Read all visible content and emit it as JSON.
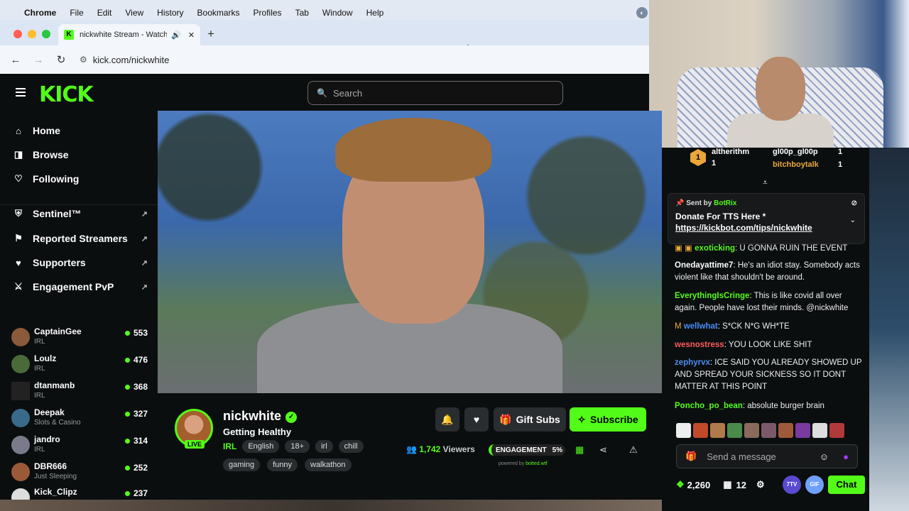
{
  "menubar": {
    "apple": "",
    "items": [
      "Chrome",
      "File",
      "Edit",
      "View",
      "History",
      "Bookmarks",
      "Profiles",
      "Tab",
      "Window",
      "Help"
    ]
  },
  "browser": {
    "tab_title": "nickwhite Stream - Watch",
    "tab_close": "✕",
    "new_tab": "+",
    "url": "kick.com/nickwhite"
  },
  "kick": {
    "logo": "KICK",
    "search_placeholder": "Search"
  },
  "sidebar": {
    "nav": [
      {
        "label": "Home",
        "icon": "home-icon",
        "glyph": "⌂"
      },
      {
        "label": "Browse",
        "icon": "browse-icon",
        "glyph": "◨"
      },
      {
        "label": "Following",
        "icon": "heart-icon",
        "glyph": "♡"
      }
    ],
    "tools": [
      {
        "label": "Sentinel™",
        "glyph": "⛨"
      },
      {
        "label": "Reported Streamers",
        "glyph": "⚑"
      },
      {
        "label": "Supporters",
        "glyph": "♥"
      },
      {
        "label": "Engagement PvP",
        "glyph": "⚔"
      }
    ],
    "channels": [
      {
        "name": "CaptainGee",
        "category": "IRL",
        "viewers": "553"
      },
      {
        "name": "Loulz",
        "category": "IRL",
        "viewers": "476"
      },
      {
        "name": "dtanmanb",
        "category": "IRL",
        "viewers": "368"
      },
      {
        "name": "Deepak",
        "category": "Slots & Casino",
        "viewers": "327"
      },
      {
        "name": "jandro",
        "category": "IRL",
        "viewers": "314"
      },
      {
        "name": "DBR666",
        "category": "Just Sleeping",
        "viewers": "252"
      },
      {
        "name": "Kick_Clipz",
        "category": "",
        "viewers": "237"
      }
    ]
  },
  "stream": {
    "streamer": "nickwhite",
    "title": "Getting Healthy",
    "category": "IRL",
    "live_badge": "LIVE",
    "tags": [
      "English",
      "18+",
      "irl",
      "chill"
    ],
    "tags2": [
      "gaming",
      "funny",
      "walkathon"
    ],
    "gift_subs": "Gift Subs",
    "subscribe": "Subscribe",
    "viewers_count": "1,742",
    "viewers_label": "Viewers",
    "engagement_label": "ENGAGEMENT",
    "engagement_pct": "5%",
    "powered_by": "powered by",
    "powered_brand": "botted.wtf"
  },
  "chat": {
    "gifters": [
      {
        "name": "altherithm",
        "count": "1"
      },
      {
        "name": "gl00p_gl00p",
        "count": "1"
      },
      {
        "name": "bitchboytalk",
        "count": "1"
      }
    ],
    "rank": "1",
    "pinned": {
      "sent_by": "Sent by",
      "bot": "BotRix",
      "message": "Donate For TTS Here *",
      "link": "https://kickbot.com/tips/nickwhite"
    },
    "messages": [
      {
        "user": "exoticking",
        "color": "#53fc18",
        "text": "U GONNA RUIN THE EVENT"
      },
      {
        "user": "Onedayattime7",
        "color": "#ffffff",
        "text": "He's an idiot stay. Somebody acts violent like that shouldn't be around."
      },
      {
        "user": "EverythingIsCringe",
        "color": "#53fc18",
        "text": "This is like covid all over again. People have lost their minds. @nickwhite"
      },
      {
        "user": "wellwhat",
        "color": "#4a8df5",
        "text": "S*CK N*G WH*TE"
      },
      {
        "user": "wesnostress",
        "color": "#ff5a5a",
        "text": "YOU LOOK LIKE SHIT"
      },
      {
        "user": "zephyrvx",
        "color": "#4a8df5",
        "text": "ICE SAID YOU ALREADY SHOWED UP AND SPREAD YOUR SICKNESS SO IT DONT MATTER AT THIS POINT"
      },
      {
        "user": "Poncho_po_bean",
        "color": "#53fc18",
        "text": "absolute burger brain"
      }
    ],
    "send_placeholder": "Send a message",
    "points": "2,260",
    "subs_count": "12",
    "badge_7tv": "7TV",
    "badge_gif": "GIF",
    "chat_button": "Chat"
  },
  "colors": {
    "kick_green": "#53fc18",
    "background": "#0b0e0f"
  }
}
